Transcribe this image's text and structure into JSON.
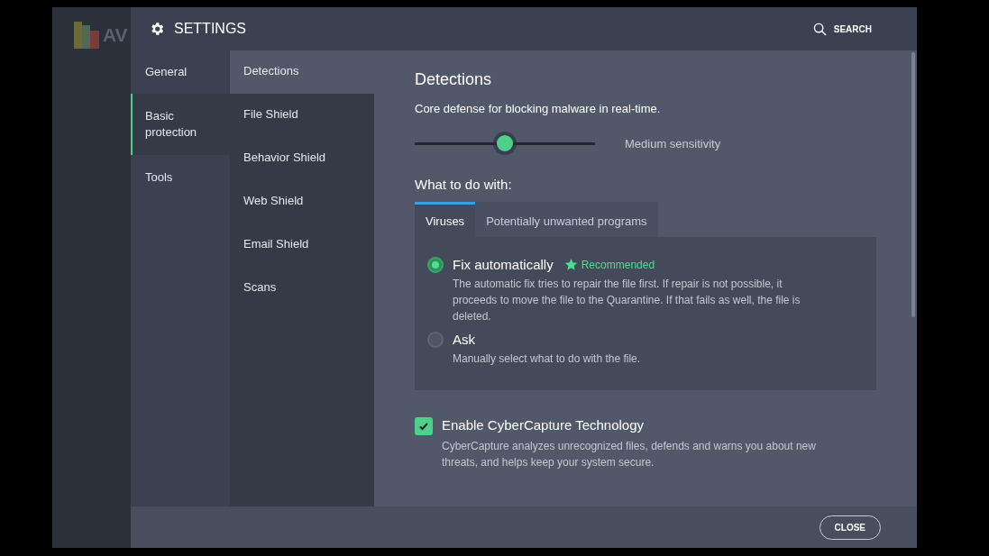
{
  "background_app": {
    "logo_text": "AV"
  },
  "window": {
    "title": "SETTINGS",
    "search_label": "SEARCH"
  },
  "nav": [
    {
      "label": "General",
      "selected": false
    },
    {
      "label": "Basic protection",
      "selected": true
    },
    {
      "label": "Tools",
      "selected": false
    }
  ],
  "subnav": [
    {
      "label": "Detections",
      "selected": true
    },
    {
      "label": "File Shield",
      "selected": false
    },
    {
      "label": "Behavior Shield",
      "selected": false
    },
    {
      "label": "Web Shield",
      "selected": false
    },
    {
      "label": "Email Shield",
      "selected": false
    },
    {
      "label": "Scans",
      "selected": false
    }
  ],
  "content": {
    "heading": "Detections",
    "description": "Core defense for blocking malware in real-time.",
    "sensitivity": {
      "level": 0.5,
      "reading": "Medium sensitivity"
    },
    "what_to_do_label": "What to do with:",
    "tabs": [
      {
        "label": "Viruses",
        "selected": true
      },
      {
        "label": "Potentially unwanted programs",
        "selected": false
      }
    ],
    "options": [
      {
        "label": "Fix automatically",
        "selected": true,
        "badge": "Recommended",
        "description": "The automatic fix tries to repair the file first. If repair is not possible, it proceeds to move the file to the Quarantine. If that fails as well, the file is deleted."
      },
      {
        "label": "Ask",
        "selected": false,
        "description": "Manually select what to do with the file."
      }
    ],
    "cybercapture": {
      "label": "Enable CyberCapture Technology",
      "checked": true,
      "description": "CyberCapture analyzes unrecognized files, defends and warns you about new threats, and helps keep your system secure."
    }
  },
  "footer": {
    "close_button": "CLOSE"
  }
}
